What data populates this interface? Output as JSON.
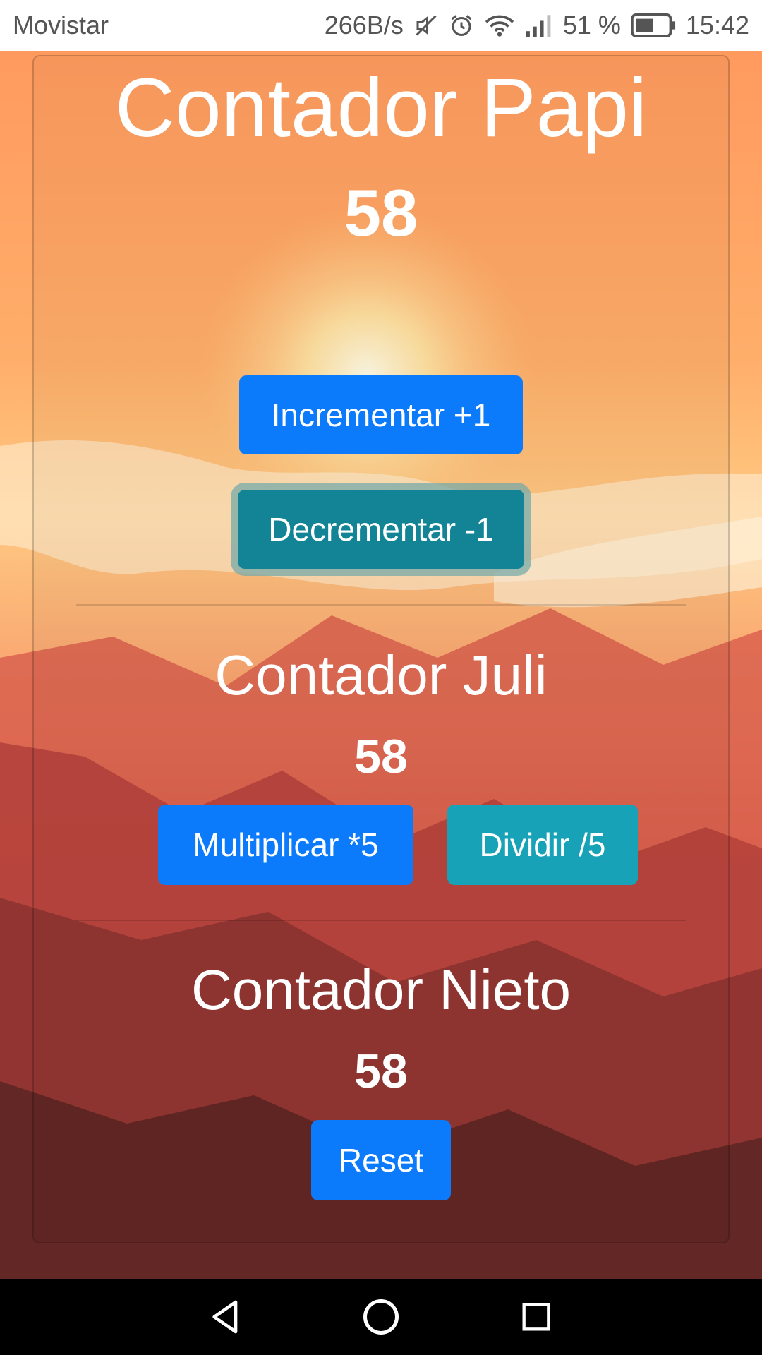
{
  "status_bar": {
    "carrier": "Movistar",
    "speed": "266B/s",
    "battery": "51 %",
    "time": "15:42",
    "icons": [
      "mute-icon",
      "alarm-icon",
      "wifi-icon",
      "signal-icon",
      "battery-icon"
    ]
  },
  "papi": {
    "title": "Contador Papi",
    "count": "58",
    "increment_label": "Incrementar +1",
    "decrement_label": "Decrementar -1"
  },
  "juli": {
    "title": "Contador Juli",
    "count": "58",
    "multiply_label": "Multiplicar *5",
    "divide_label": "Dividir /5"
  },
  "nieto": {
    "title": "Contador Nieto",
    "count": "58",
    "reset_label": "Reset"
  },
  "nav_bar": {
    "icons": [
      "back-icon",
      "home-icon",
      "recents-icon"
    ]
  },
  "colors": {
    "primary": "#0b7bfc",
    "info": "#17a2b8",
    "info_focused": "#138496"
  }
}
